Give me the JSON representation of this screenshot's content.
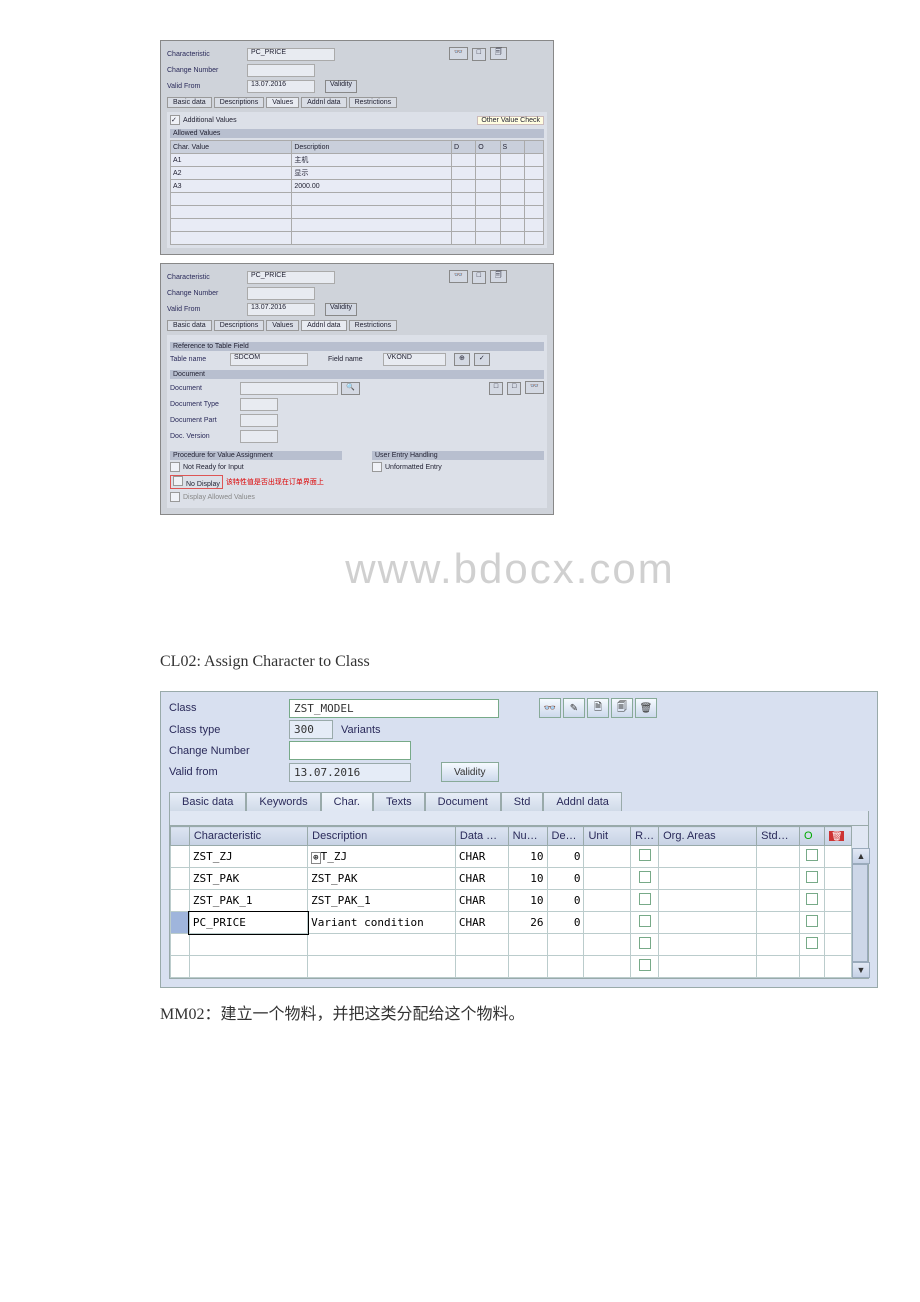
{
  "mini1": {
    "characteristic_label": "Characteristic",
    "characteristic_value": "PC_PRICE",
    "change_number_label": "Change Number",
    "valid_from_label": "Valid From",
    "valid_from_value": "13.07.2016",
    "validity_btn": "Validity",
    "tabs": [
      "Basic data",
      "Descriptions",
      "Values",
      "Addnl data",
      "Restrictions"
    ],
    "additional_values_label": "Additional Values",
    "other_value_check_label": "Other Value Check",
    "allowed_values_label": "Allowed Values",
    "col_char": "Char. Value",
    "col_desc": "Description",
    "col_d": "D",
    "col_o": "O",
    "col_s": "S",
    "rows": [
      {
        "val": "A1",
        "desc": "主机"
      },
      {
        "val": "A2",
        "desc": "显示"
      },
      {
        "val": "A3",
        "desc": "2000.00"
      }
    ]
  },
  "mini2": {
    "characteristic_label": "Characteristic",
    "characteristic_value": "PC_PRICE",
    "change_number_label": "Change Number",
    "valid_from_label": "Valid From",
    "valid_from_value": "13.07.2016",
    "validity_btn": "Validity",
    "tabs": [
      "Basic data",
      "Descriptions",
      "Values",
      "Addnl data",
      "Restrictions"
    ],
    "ref_section": "Reference to Table Field",
    "table_name_label": "Table name",
    "table_name_value": "SDCOM",
    "field_name_label": "Field name",
    "field_name_value": "VKOND",
    "document_section": "Document",
    "document_label": "Document",
    "document_type_label": "Document Type",
    "document_part_label": "Document Part",
    "doc_version_label": "Doc. Version",
    "procedure_section": "Procedure for Value Assignment",
    "user_entry_section": "User Entry Handling",
    "not_ready_label": "Not Ready for Input",
    "unformatted_label": "Unformatted Entry",
    "no_display_label": "No Display",
    "chinese_note": "该特性值是否出现在订单界面上",
    "display_allowed_label": "Display Allowed Values"
  },
  "watermark": "www.bdocx.com",
  "cl02_heading": "CL02: Assign Character to Class",
  "class_form": {
    "class_label": "Class",
    "class_value": "ZST_MODEL",
    "icons": {
      "glasses": "👓",
      "edit": "✎",
      "doc": "🗎",
      "copy": "🗐",
      "delete": "🗑"
    },
    "class_type_label": "Class type",
    "class_type_value": "300",
    "class_type_desc": "Variants",
    "change_number_label": "Change Number",
    "valid_from_label": "Valid from",
    "valid_from_value": "13.07.2016",
    "validity_btn": "Validity",
    "tabs": [
      "Basic data",
      "Keywords",
      "Char.",
      "Texts",
      "Document",
      "Std",
      "Addnl data"
    ],
    "columns": {
      "characteristic": "Characteristic",
      "description": "Description",
      "data": "Data …",
      "nu": "Nu…",
      "de": "De…",
      "unit": "Unit",
      "r": "R…",
      "org_areas": "Org. Areas",
      "std": "Std…",
      "o": "O",
      "del": "🗑"
    },
    "rows": [
      {
        "ch": "ZST_ZJ",
        "desc_icon": "⊕",
        "desc": "T_ZJ",
        "data": "CHAR",
        "nu": "10",
        "de": "0"
      },
      {
        "ch": "ZST_PAK",
        "desc": "ZST_PAK",
        "data": "CHAR",
        "nu": "10",
        "de": "0"
      },
      {
        "ch": "ZST_PAK_1",
        "desc": "ZST_PAK_1",
        "data": "CHAR",
        "nu": "10",
        "de": "0"
      },
      {
        "ch": "PC_PRICE",
        "desc": "Variant condition",
        "data": "CHAR",
        "nu": "26",
        "de": "0"
      }
    ]
  },
  "mm02_note": "MM02：建立一个物料，并把这类分配给这个物料。"
}
